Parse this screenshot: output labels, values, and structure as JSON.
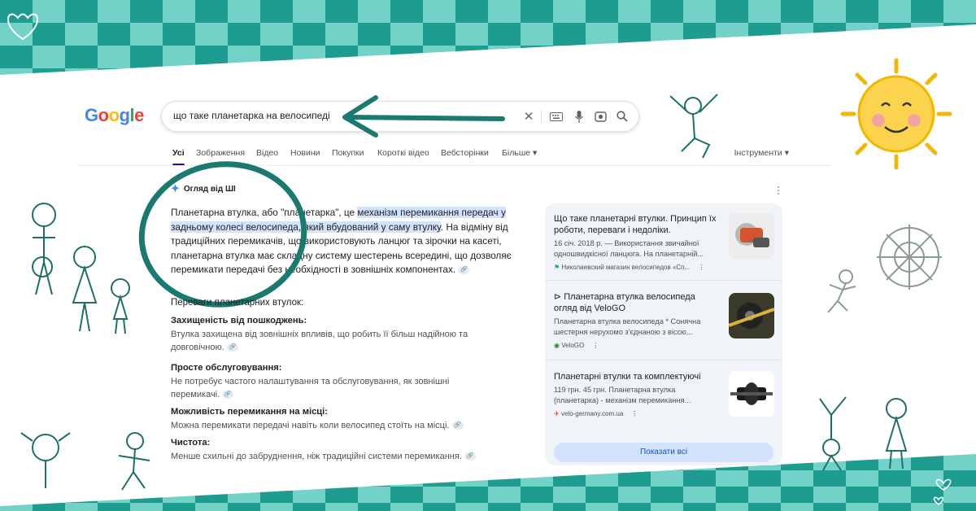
{
  "search": {
    "query": "що таке планетарка на велосипеді"
  },
  "tabs": [
    "Усі",
    "Зображення",
    "Відео",
    "Новини",
    "Покупки",
    "Короткі відео",
    "Вебсторінки",
    "Більше ▾"
  ],
  "tools_label": "Інструменти ▾",
  "ai_overview": {
    "heading": "Огляд від ШІ",
    "para_a": "Планетарна втулка, або \"планетарка\", це ",
    "para_hl": "механізм перемикання передач у задньому колесі велосипеда, який вбудований у саму втулку",
    "para_b": ". На відміну від традиційних перемикачів, що використовують ланцюг та зірочки на касеті, планетарна втулка має складну систему шестерень всередині, що дозволяє перемикати передачі без необхідності в зовнішніх компонентах."
  },
  "advantages_heading": "Переваги планетарних втулок:",
  "advantages": [
    {
      "title": "Захищеність від пошкоджень:",
      "desc": "Втулка захищена від зовнішніх впливів, що робить її більш надійною та довговічною."
    },
    {
      "title": "Просте обслуговування:",
      "desc": "Не потребує частого налаштування та обслуговування, як зовнішні перемикачі."
    },
    {
      "title": "Можливість перемикання на місці:",
      "desc": "Можна перемикати передачі навіть коли велосипед стоїть на місці."
    },
    {
      "title": "Чистота:",
      "desc": "Менше схильні до забруднення, ніж традиційні системи перемикання."
    }
  ],
  "sources": [
    {
      "title": "Що таке планетарні втулки. Принцип їх роботи, переваги і недоліки.",
      "snippet": "16 січ. 2018 р. — Використання звичайної одношвидкісної ланцюга. На планетарній...",
      "site": "Николаевский магазин велосипедов «Сп..."
    },
    {
      "title": "⊳ Планетарна втулка велосипеда огляд від VeloGO",
      "snippet": "Планетарна втулка велосипеда * Сонячна шестерня нерухомо з'єднаною з віссю...",
      "site": "VeloGO"
    },
    {
      "title": "Планетарні втулки та комплектуючі",
      "snippet": "119 грн. 45 грн. Планетарна втулка (планетарка) - механізм перемикання...",
      "site": "velo-germany.com.ua"
    }
  ],
  "show_all": "Показати всі",
  "colors": {
    "accent_teal": "#1f8a7f",
    "light_teal": "#6fd0c6",
    "link_blue": "#0b57d0"
  }
}
